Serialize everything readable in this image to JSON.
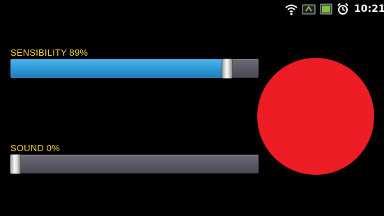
{
  "status_bar": {
    "time": "10:21",
    "icons": [
      "wifi-icon",
      "sync-icon",
      "battery-icon",
      "alarm-icon"
    ]
  },
  "sensibility": {
    "label": "SENSIBILITY 89%",
    "value_percent": 89
  },
  "sound": {
    "label": "SOUND 0%",
    "value_percent": 0
  },
  "indicator": {
    "color": "#ee1c25"
  },
  "colors": {
    "label": "#f3d230",
    "slider_fill": "#2e98d6",
    "background": "#000000"
  }
}
